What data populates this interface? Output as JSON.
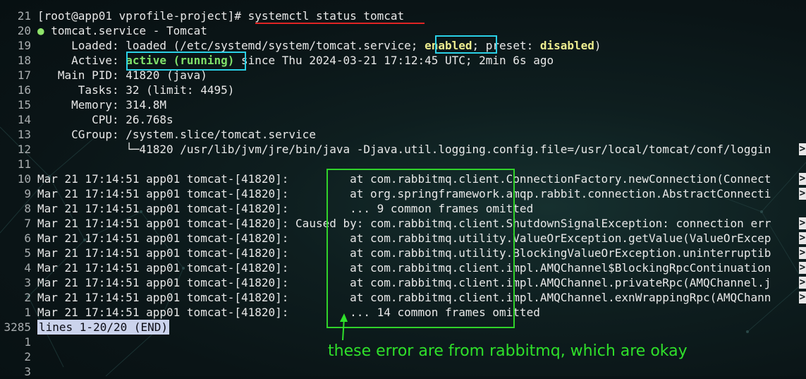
{
  "colors": {
    "background": "#0a1416",
    "text": "#e8e8e8",
    "line_number": "#a9aeb0",
    "accent_green": "#7fe06a",
    "accent_yellow": "#ecec8f",
    "underline_red": "#e02424",
    "highlight_cyan": "#2ad0e6",
    "annotation_green": "#2fe02a"
  },
  "terminal": {
    "prompt_prefix": "[root@app01 vprofile-project]# ",
    "command": "systemctl status tomcat",
    "lines": [
      {
        "n": "21",
        "segments": [
          {
            "t": "[root@app01 vprofile-project]# "
          },
          {
            "t": "systemctl status tomcat"
          }
        ]
      },
      {
        "n": "20",
        "segments": [
          {
            "t": "●",
            "c": "dot"
          },
          {
            "t": " tomcat.service - Tomcat"
          }
        ]
      },
      {
        "n": "19",
        "segments": [
          {
            "t": "     Loaded: loaded (/etc/systemd/system/tomcat.service; "
          },
          {
            "t": "enabled",
            "c": "bold-yellow"
          },
          {
            "t": "; preset: "
          },
          {
            "t": "disabled",
            "c": "bold-yellow"
          },
          {
            "t": ")"
          }
        ]
      },
      {
        "n": "18",
        "segments": [
          {
            "t": "     Active: "
          },
          {
            "t": "active (running)",
            "c": "green"
          },
          {
            "t": " since Thu 2024-03-21 17:12:45 UTC; 2min 6s ago"
          }
        ]
      },
      {
        "n": "17",
        "segments": [
          {
            "t": "   Main PID: 41820 (java)"
          }
        ]
      },
      {
        "n": "16",
        "segments": [
          {
            "t": "      Tasks: 32 (limit: 4495)"
          }
        ]
      },
      {
        "n": "15",
        "segments": [
          {
            "t": "     Memory: 314.8M"
          }
        ]
      },
      {
        "n": "14",
        "segments": [
          {
            "t": "        CPU: 26.768s"
          }
        ]
      },
      {
        "n": "13",
        "segments": [
          {
            "t": "     CGroup: /system.slice/tomcat.service"
          }
        ]
      },
      {
        "n": "12",
        "segments": [
          {
            "t": "             └─41820 /usr/lib/jvm/jre/bin/java -Djava.util.logging.config.file=/usr/local/tomcat/conf/loggin"
          }
        ],
        "cut": true
      },
      {
        "n": "11",
        "segments": [
          {
            "t": ""
          }
        ]
      },
      {
        "n": "10",
        "segments": [
          {
            "t": "Mar 21 17:14:51 app01 tomcat-[41820]:         at com.rabbitmq.client.ConnectionFactory.newConnection(Connect"
          }
        ],
        "cut": true
      },
      {
        "n": "9",
        "segments": [
          {
            "t": "Mar 21 17:14:51 app01 tomcat-[41820]:         at org.springframework.amqp.rabbit.connection.AbstractConnecti"
          }
        ],
        "cut": true
      },
      {
        "n": "8",
        "segments": [
          {
            "t": "Mar 21 17:14:51 app01 tomcat-[41820]:         ... 9 common frames omitted"
          }
        ]
      },
      {
        "n": "7",
        "segments": [
          {
            "t": "Mar 21 17:14:51 app01 tomcat-[41820]: Caused by: com.rabbitmq.client.ShutdownSignalException: connection err"
          }
        ],
        "cut": true
      },
      {
        "n": "6",
        "segments": [
          {
            "t": "Mar 21 17:14:51 app01 tomcat-[41820]:         at com.rabbitmq.utility.ValueOrException.getValue(ValueOrExcep"
          }
        ],
        "cut": true
      },
      {
        "n": "5",
        "segments": [
          {
            "t": "Mar 21 17:14:51 app01 tomcat-[41820]:         at com.rabbitmq.utility.BlockingValueOrException.uninterruptib"
          }
        ],
        "cut": true
      },
      {
        "n": "4",
        "segments": [
          {
            "t": "Mar 21 17:14:51 app01 tomcat-[41820]:         at com.rabbitmq.client.impl.AMQChannel$BlockingRpcContinuation"
          }
        ],
        "cut": true
      },
      {
        "n": "3",
        "segments": [
          {
            "t": "Mar 21 17:14:51 app01 tomcat-[41820]:         at com.rabbitmq.client.impl.AMQChannel.privateRpc(AMQChannel.j"
          }
        ],
        "cut": true
      },
      {
        "n": "2",
        "segments": [
          {
            "t": "Mar 21 17:14:51 app01 tomcat-[41820]:         at com.rabbitmq.client.impl.AMQChannel.exnWrappingRpc(AMQChann"
          }
        ],
        "cut": true
      },
      {
        "n": "1",
        "segments": [
          {
            "t": "Mar 21 17:14:51 app01 tomcat-[41820]:         ... 14 common frames omitted"
          }
        ]
      },
      {
        "n": "3285",
        "segments": [
          {
            "t": "lines 1-20/20 (END)",
            "c": "status"
          }
        ]
      },
      {
        "n": "1",
        "segments": [
          {
            "t": ""
          }
        ]
      },
      {
        "n": "2",
        "segments": [
          {
            "t": ""
          }
        ]
      },
      {
        "n": "3",
        "segments": [
          {
            "t": ""
          }
        ]
      }
    ],
    "cut_marker": ">"
  },
  "annotation": {
    "text": "these error are from rabbitmq, which are okay"
  }
}
